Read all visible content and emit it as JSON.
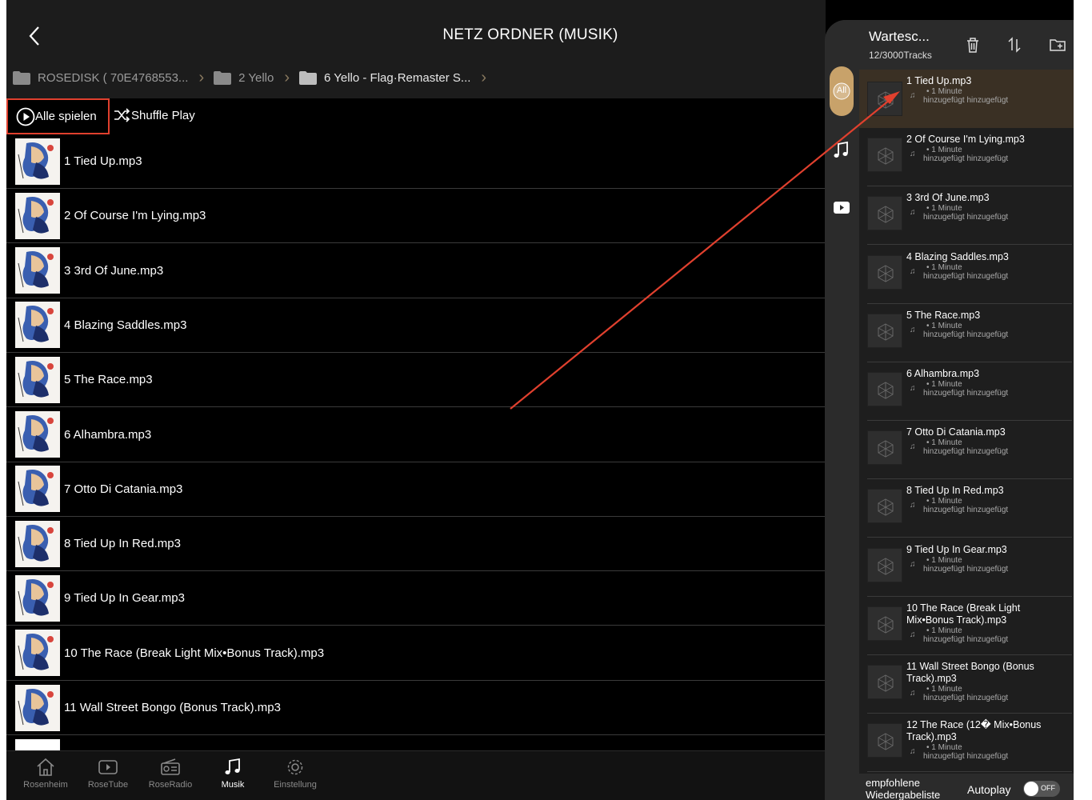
{
  "header": {
    "title": "NETZ ORDNER (MUSIK)"
  },
  "breadcrumb": [
    {
      "label": "ROSEDISK ( 70E4768553..."
    },
    {
      "label": "2 Yello"
    },
    {
      "label": "6 Yello - Flag·Remaster S..."
    }
  ],
  "actions": {
    "play_all": "Alle spielen",
    "shuffle": "Shuffle Play"
  },
  "tracks": [
    "1 Tied Up.mp3",
    "2 Of Course I'm Lying.mp3",
    "3 3rd Of June.mp3",
    "4 Blazing Saddles.mp3",
    "5 The Race.mp3",
    "6 Alhambra.mp3",
    "7 Otto Di Catania.mp3",
    "8 Tied Up In Red.mp3",
    "9 Tied Up In Gear.mp3",
    "10 The Race (Break Light Mix•Bonus Track).mp3",
    "11 Wall Street Bongo (Bonus Track).mp3"
  ],
  "tabs": [
    "Rosenheim",
    "RoseTube",
    "RoseRadio",
    "Musik",
    "Einstellung"
  ],
  "active_tab": "Musik",
  "queue": {
    "title": "Wartesc...",
    "count": "12/3000Tracks",
    "filter_all": "All",
    "meta_duration": "• 1 Minute",
    "meta_added": "hinzugefügt hinzugefügt",
    "items": [
      {
        "name": "1 Tied Up.mp3",
        "current": true
      },
      {
        "name": "2 Of Course I'm Lying.mp3"
      },
      {
        "name": "3 3rd Of June.mp3"
      },
      {
        "name": "4 Blazing Saddles.mp3"
      },
      {
        "name": "5 The Race.mp3"
      },
      {
        "name": "6 Alhambra.mp3"
      },
      {
        "name": "7 Otto Di Catania.mp3"
      },
      {
        "name": "8 Tied Up In Red.mp3"
      },
      {
        "name": "9 Tied Up In Gear.mp3"
      },
      {
        "name": "10 The Race (Break Light Mix•Bonus Track).mp3"
      },
      {
        "name": "11 Wall Street Bongo (Bonus Track).mp3"
      },
      {
        "name": "12 The Race (12� Mix•Bonus Track).mp3"
      }
    ],
    "footer": {
      "recommended": "empfohlene Wiedergabeliste",
      "autoplay": "Autoplay",
      "autoplay_state": "OFF"
    }
  },
  "colors": {
    "accent_gold": "#c8a26a",
    "highlight_box": "#e0402e",
    "current_row": "#3a3024"
  }
}
